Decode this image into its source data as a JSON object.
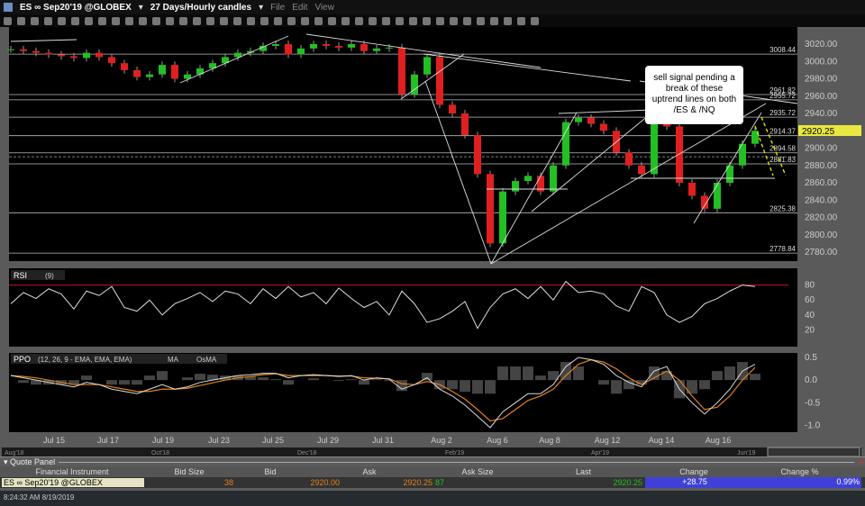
{
  "window": {
    "symbol": "ES ∞ Sep20'19 @GLOBEX",
    "timeframe": "27 Days/Hourly candles",
    "menu": [
      "File",
      "Edit",
      "View"
    ]
  },
  "annotation": "sell signal pending a break of these uptrend lines on both /ES & /NQ",
  "colors": {
    "up": "#22c022",
    "down": "#e02020",
    "last_price_bg": "#e8e840",
    "rsi_line": "#c8102e",
    "ma": "#e08020",
    "change_bg": "#4040d8"
  },
  "chart_data": [
    {
      "type": "candlestick",
      "panel": "price",
      "ylim": [
        2770,
        3030
      ],
      "y_ticks": [
        "3020.00",
        "3000.00",
        "2980.00",
        "2960.00",
        "2940.00",
        "2920.00",
        "2900.00",
        "2880.00",
        "2860.00",
        "2840.00",
        "2820.00",
        "2800.00",
        "2780.00"
      ],
      "x_ticks": [
        "Jul 15",
        "Jul 17",
        "Jul 19",
        "Jul 23",
        "Jul 25",
        "Jul 29",
        "Jul 31",
        "Aug 2",
        "Aug 6",
        "Aug 8",
        "Aug 12",
        "Aug 14",
        "Aug 16"
      ],
      "last_price": "2920.25",
      "levels": [
        {
          "label": "3008.44",
          "v": 3008.44
        },
        {
          "label": "2961.82",
          "v": 2961.82
        },
        {
          "label": "2955.72",
          "v": 2955.72
        },
        {
          "label": "2935.72",
          "v": 2935.72
        },
        {
          "label": "2914.37",
          "v": 2914.37
        },
        {
          "label": "2894.58",
          "v": 2894.58
        },
        {
          "label": "2881.83",
          "v": 2881.83
        },
        {
          "label": "2825.38",
          "v": 2825.38
        },
        {
          "label": "2778.84",
          "v": 2778.84
        }
      ],
      "closes": [
        3014,
        3012,
        3010,
        3008,
        3006,
        3004,
        3010,
        3005,
        2998,
        2990,
        2982,
        2985,
        2996,
        2980,
        2985,
        2992,
        2998,
        3005,
        3010,
        3012,
        3018,
        3020,
        3008,
        3015,
        3020,
        3018,
        3016,
        3020,
        3012,
        3015,
        3016,
        2962,
        2985,
        3005,
        2950,
        2940,
        2915,
        2870,
        2790,
        2850,
        2862,
        2868,
        2850,
        2880,
        2930,
        2935,
        2928,
        2920,
        2895,
        2880,
        2870,
        2935,
        2925,
        2860,
        2845,
        2830,
        2860,
        2880,
        2905,
        2920
      ]
    },
    {
      "type": "line",
      "panel": "rsi",
      "title": "RSI",
      "params": "(9)",
      "ylim": [
        0,
        100
      ],
      "y_ticks": [
        "80",
        "60",
        "40",
        "20"
      ],
      "overbought": 80,
      "values": [
        55,
        70,
        62,
        75,
        68,
        48,
        72,
        66,
        78,
        50,
        45,
        60,
        40,
        55,
        62,
        70,
        58,
        72,
        68,
        55,
        75,
        62,
        78,
        64,
        70,
        55,
        76,
        62,
        50,
        58,
        40,
        72,
        55,
        30,
        35,
        45,
        58,
        22,
        50,
        68,
        75,
        62,
        78,
        60,
        85,
        70,
        72,
        68,
        52,
        45,
        78,
        70,
        40,
        30,
        38,
        55,
        62,
        72,
        80,
        78
      ]
    },
    {
      "type": "line",
      "panel": "ppo",
      "title": "PPO",
      "params": "(12, 26, 9 - EMA, EMA, EMA)",
      "legend": [
        "MA",
        "OsMA"
      ],
      "ylim": [
        -1.15,
        0.6
      ],
      "y_ticks": [
        "0.5",
        "0.0",
        "-0.5",
        "-1.0"
      ],
      "ppo": [
        0.1,
        0.05,
        0.0,
        -0.05,
        -0.1,
        -0.15,
        -0.05,
        -0.1,
        -0.2,
        -0.25,
        -0.3,
        -0.2,
        -0.1,
        -0.2,
        -0.15,
        -0.05,
        0.0,
        0.05,
        0.1,
        0.12,
        0.15,
        0.15,
        0.05,
        0.1,
        0.12,
        0.1,
        0.08,
        0.1,
        0.0,
        0.05,
        0.02,
        -0.2,
        -0.1,
        0.05,
        -0.2,
        -0.35,
        -0.55,
        -0.8,
        -1.05,
        -0.7,
        -0.5,
        -0.3,
        -0.3,
        -0.1,
        0.3,
        0.5,
        0.45,
        0.35,
        0.1,
        -0.05,
        -0.15,
        0.2,
        0.3,
        -0.2,
        -0.5,
        -0.75,
        -0.5,
        -0.2,
        0.2,
        0.35
      ],
      "ma": [
        0.1,
        0.08,
        0.05,
        0.0,
        -0.05,
        -0.1,
        -0.1,
        -0.1,
        -0.15,
        -0.2,
        -0.25,
        -0.25,
        -0.2,
        -0.2,
        -0.18,
        -0.12,
        -0.06,
        0.0,
        0.05,
        0.08,
        0.12,
        0.14,
        0.1,
        0.1,
        0.1,
        0.1,
        0.09,
        0.09,
        0.05,
        0.04,
        0.03,
        -0.08,
        -0.1,
        -0.03,
        -0.1,
        -0.25,
        -0.42,
        -0.65,
        -0.9,
        -0.85,
        -0.65,
        -0.45,
        -0.35,
        -0.2,
        0.1,
        0.35,
        0.45,
        0.4,
        0.25,
        0.05,
        -0.1,
        0.05,
        0.2,
        0.0,
        -0.35,
        -0.65,
        -0.6,
        -0.35,
        0.0,
        0.28
      ]
    },
    {
      "type": "navigator",
      "x_ticks": [
        "Aug'18",
        "Oct'18",
        "Dec'18",
        "Feb'19",
        "Apr'19",
        "Jun'19"
      ]
    }
  ],
  "quote_panel": {
    "title": "Quote Panel",
    "columns": [
      "Financial Instrument",
      "Bid Size",
      "Bid",
      "Ask",
      "Ask Size",
      "Last",
      "Change",
      "Change %"
    ],
    "row": {
      "instrument": "ES ∞ Sep20'19 @GLOBEX",
      "bid_size": "38",
      "bid": "2920.00",
      "ask": "2920.25",
      "ask_size": "87",
      "last": "2920.25",
      "change": "+28.75",
      "change_pct": "0.99%"
    }
  },
  "status": {
    "timestamp": "8:24:32 AM 8/19/2019"
  }
}
